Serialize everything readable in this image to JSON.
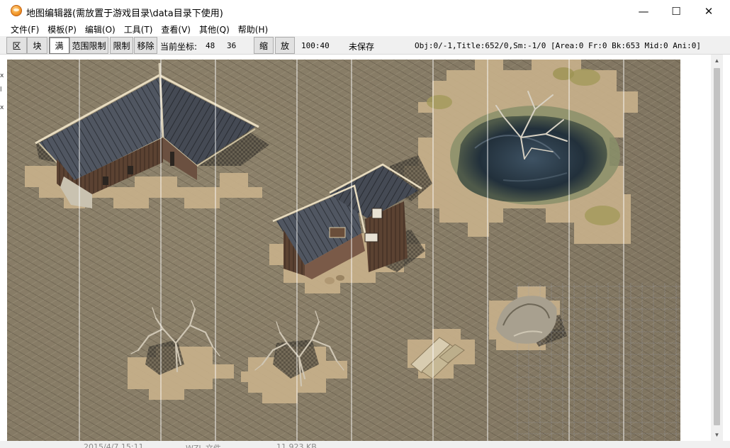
{
  "window": {
    "title": "地图编辑器(需放置于游戏目录\\data目录下使用)",
    "minimize_glyph": "—",
    "maximize_glyph": "☐",
    "close_glyph": "✕"
  },
  "menu": [
    {
      "label": "文件(F)"
    },
    {
      "label": "模板(P)"
    },
    {
      "label": "编辑(O)"
    },
    {
      "label": "工具(T)"
    },
    {
      "label": "查看(V)"
    },
    {
      "label": "其他(Q)"
    },
    {
      "label": "帮助(H)"
    }
  ],
  "toolbar": {
    "btn_area": "区",
    "btn_block": "块",
    "btn_full": "满",
    "btn_range_limit": "范围限制",
    "btn_limit": "限制",
    "btn_remove": "移除",
    "coord_label": "当前坐标:",
    "coord_x": "48",
    "coord_y": "36",
    "btn_zoom_out": "缩",
    "btn_zoom_in": "放",
    "map_size": "100:40",
    "save_state": "未保存",
    "object_info": "Obj:0/-1,Title:652/0,Sm:-1/0 [Area:0 Fr:0 Bk:653 Mid:0 Ani:0]"
  },
  "statusbar_peek": {
    "date": "2015/4/7 15:11",
    "type": "WZL 文件",
    "size": "11,923 KB"
  },
  "icons": {
    "app": "map-editor-app-icon",
    "scroll_up": "scroll-up-arrow-icon",
    "scroll_down": "scroll-down-arrow-icon"
  },
  "colors": {
    "ground": "#877c66",
    "sand": "#c9b48e",
    "roof": "#4a4f58",
    "water": "#2b3540",
    "grid_line": "#ffffff"
  }
}
